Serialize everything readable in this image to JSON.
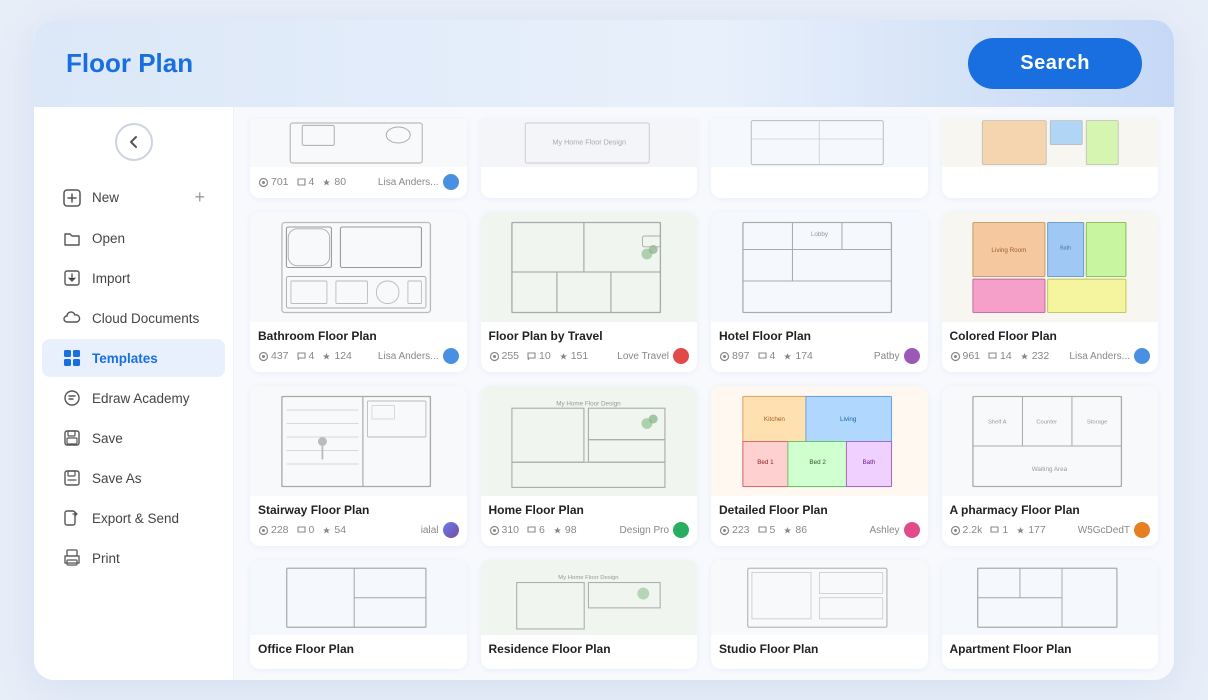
{
  "header": {
    "title": "Floor Plan",
    "search_label": "Search"
  },
  "sidebar": {
    "back_title": "Back",
    "items": [
      {
        "id": "new",
        "label": "New",
        "icon": "➕",
        "has_plus": true
      },
      {
        "id": "open",
        "label": "Open",
        "icon": "📁"
      },
      {
        "id": "import",
        "label": "Import",
        "icon": "📥"
      },
      {
        "id": "cloud",
        "label": "Cloud Documents",
        "icon": "☁️"
      },
      {
        "id": "templates",
        "label": "Templates",
        "icon": "🖼",
        "active": true
      },
      {
        "id": "edraw",
        "label": "Edraw Academy",
        "icon": "🎓"
      },
      {
        "id": "save",
        "label": "Save",
        "icon": "💾"
      },
      {
        "id": "saveas",
        "label": "Save As",
        "icon": "💾"
      },
      {
        "id": "export",
        "label": "Export & Send",
        "icon": "📤"
      },
      {
        "id": "print",
        "label": "Print",
        "icon": "🖨"
      }
    ]
  },
  "templates": {
    "cards": [
      {
        "id": "bathroom",
        "title": "Bathroom Floor Plan",
        "stats": {
          "views": "437",
          "comments": "4",
          "likes": "124"
        },
        "author": "Lisa Anders...",
        "avatar_color": "blue",
        "type": "bathroom"
      },
      {
        "id": "travel",
        "title": "Floor Plan by Travel",
        "stats": {
          "views": "255",
          "comments": "10",
          "likes": "151"
        },
        "author": "Love Travel",
        "avatar_color": "red",
        "type": "travel"
      },
      {
        "id": "hotel",
        "title": "Hotel Floor Plan",
        "stats": {
          "views": "897",
          "comments": "4",
          "likes": "174"
        },
        "author": "Patby",
        "avatar_color": "purple",
        "type": "hotel"
      },
      {
        "id": "colored",
        "title": "Colored Floor Plan",
        "stats": {
          "views": "961",
          "comments": "14",
          "likes": "232"
        },
        "author": "Lisa Anders...",
        "avatar_color": "blue",
        "type": "colored"
      },
      {
        "id": "stairway",
        "title": "Stairway Floor Plan",
        "stats": {
          "views": "228",
          "comments": "0",
          "likes": "54"
        },
        "author": "ialal",
        "avatar_color": "gradient",
        "type": "stairway"
      },
      {
        "id": "travel2",
        "title": "Home Floor Plan",
        "stats": {
          "views": "310",
          "comments": "6",
          "likes": "98"
        },
        "author": "Design Pro",
        "avatar_color": "green",
        "type": "home"
      },
      {
        "id": "detailed",
        "title": "Detailed Floor Plan",
        "stats": {
          "views": "223",
          "comments": "5",
          "likes": "86"
        },
        "author": "Ashley",
        "avatar_color": "pink",
        "type": "detailed"
      },
      {
        "id": "pharmacy",
        "title": "A pharmacy Floor Plan",
        "stats": {
          "views": "2.2k",
          "comments": "1",
          "likes": "177"
        },
        "author": "W5GcDedT",
        "avatar_color": "orange",
        "type": "pharmacy"
      }
    ],
    "partial_cards": [
      {
        "id": "top1",
        "type": "partial1",
        "stats": {
          "views": "701",
          "comments": "4",
          "likes": "80"
        },
        "author": "Lisa Anders..."
      },
      {
        "id": "top2",
        "type": "partial2"
      },
      {
        "id": "top3",
        "type": "partial3"
      },
      {
        "id": "top4",
        "type": "partial4"
      }
    ],
    "bottom_partial_cards": [
      {
        "id": "bot1",
        "type": "bot1"
      },
      {
        "id": "bot2",
        "type": "bot2"
      },
      {
        "id": "bot3",
        "type": "bot3"
      },
      {
        "id": "bot4",
        "type": "bot4"
      }
    ]
  }
}
